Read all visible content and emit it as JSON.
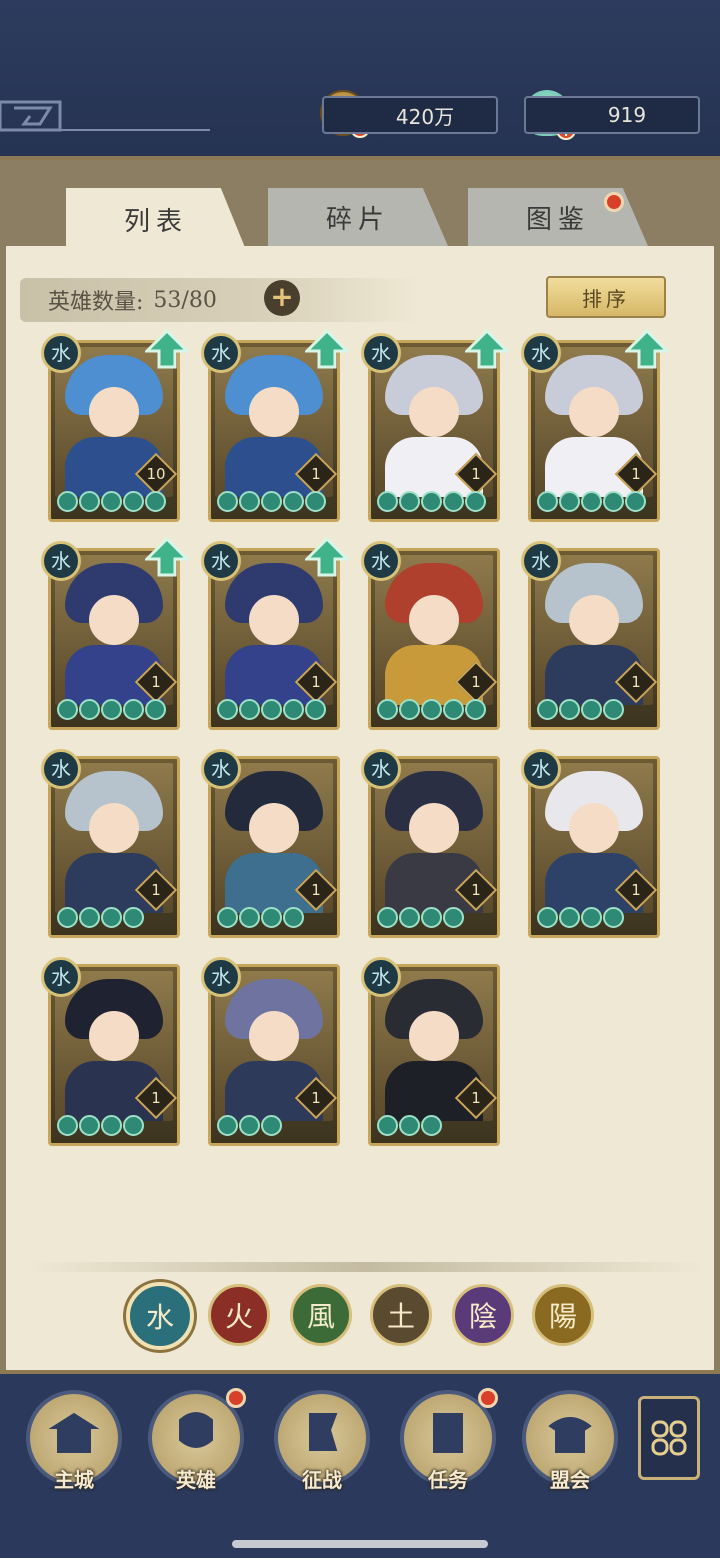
{
  "currency": {
    "coins": "420万",
    "jade": "919"
  },
  "tabs": [
    {
      "label": "列表",
      "active": true
    },
    {
      "label": "碎片",
      "active": false
    },
    {
      "label": "图鉴",
      "active": false,
      "has_notification": true
    }
  ],
  "hero_count": {
    "label": "英雄数量:",
    "value": "53/80"
  },
  "sort_label": "排序",
  "element_glyph": "水",
  "heroes": [
    {
      "name": "blue-haired-swordswoman",
      "level": "10",
      "stars": 5,
      "upgradable": true,
      "hair": "#4d8fd0",
      "outfit": "#2d4f8e"
    },
    {
      "name": "blue-haired-swordswoman",
      "level": "1",
      "stars": 5,
      "upgradable": true,
      "hair": "#4d8fd0",
      "outfit": "#2d4f8e"
    },
    {
      "name": "silver-haired-scholar",
      "level": "1",
      "stars": 5,
      "upgradable": true,
      "hair": "#c7ccd8",
      "outfit": "#f0f0f4"
    },
    {
      "name": "silver-haired-scholar",
      "level": "1",
      "stars": 5,
      "upgradable": true,
      "hair": "#c7ccd8",
      "outfit": "#f0f0f4"
    },
    {
      "name": "opera-masked-lady",
      "level": "1",
      "stars": 5,
      "upgradable": true,
      "hair": "#2f3a6e",
      "outfit": "#33428a"
    },
    {
      "name": "opera-masked-lady",
      "level": "1",
      "stars": 5,
      "upgradable": true,
      "hair": "#2f3a6e",
      "outfit": "#33428a"
    },
    {
      "name": "red-haired-dancer",
      "level": "1",
      "stars": 5,
      "upgradable": false,
      "hair": "#b0402e",
      "outfit": "#c89a3a"
    },
    {
      "name": "white-fur-general",
      "level": "1",
      "stars": 4,
      "upgradable": false,
      "hair": "#b6c2cc",
      "outfit": "#2d3c5c"
    },
    {
      "name": "white-fur-general",
      "level": "1",
      "stars": 4,
      "upgradable": false,
      "hair": "#b6c2cc",
      "outfit": "#2d3c5c"
    },
    {
      "name": "flower-maiden",
      "level": "1",
      "stars": 4,
      "upgradable": false,
      "hair": "#222a3c",
      "outfit": "#3f6f8e"
    },
    {
      "name": "masked-hat-swordsman",
      "level": "1",
      "stars": 4,
      "upgradable": false,
      "hair": "#2a2f44",
      "outfit": "#3a3a44"
    },
    {
      "name": "white-hooded-lady",
      "level": "1",
      "stars": 4,
      "upgradable": false,
      "hair": "#e8e8ec",
      "outfit": "#2e4268"
    },
    {
      "name": "crowned-official",
      "level": "1",
      "stars": 4,
      "upgradable": false,
      "hair": "#1f2230",
      "outfit": "#2a3450"
    },
    {
      "name": "purple-haired-warrior",
      "level": "1",
      "stars": 3,
      "upgradable": false,
      "hair": "#6e73a0",
      "outfit": "#2d3a5a"
    },
    {
      "name": "hooded-assassin",
      "level": "1",
      "stars": 3,
      "upgradable": false,
      "hair": "#2a2c34",
      "outfit": "#1e2028"
    }
  ],
  "element_filters": [
    {
      "glyph": "水",
      "name": "water",
      "color": "#2b6f7a",
      "selected": true
    },
    {
      "glyph": "火",
      "name": "fire",
      "color": "#8a2e26",
      "selected": false
    },
    {
      "glyph": "風",
      "name": "wind",
      "color": "#3c6b38",
      "selected": false
    },
    {
      "glyph": "土",
      "name": "earth",
      "color": "#5a4a30",
      "selected": false
    },
    {
      "glyph": "陰",
      "name": "yin",
      "color": "#5a3a78",
      "selected": false
    },
    {
      "glyph": "陽",
      "name": "yang",
      "color": "#8a6a20",
      "selected": false
    }
  ],
  "nav": [
    {
      "label": "主城",
      "icon": "city-gate-icon",
      "has_notification": false
    },
    {
      "label": "英雄",
      "icon": "hero-portrait-icon",
      "has_notification": true
    },
    {
      "label": "征战",
      "icon": "battle-flag-icon",
      "has_notification": false
    },
    {
      "label": "任务",
      "icon": "scroll-task-icon",
      "has_notification": true
    },
    {
      "label": "盟会",
      "icon": "pavilion-icon",
      "has_notification": false
    }
  ]
}
